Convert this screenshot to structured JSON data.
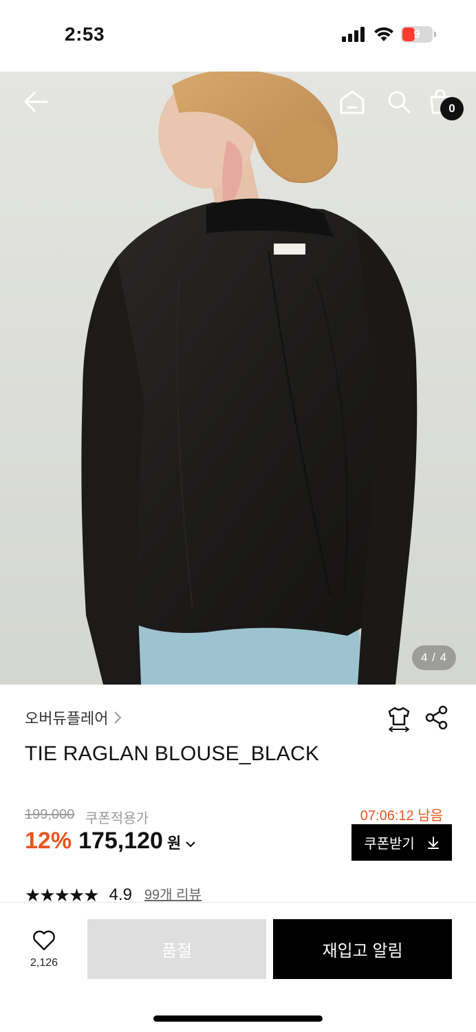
{
  "status_bar": {
    "time": "2:53",
    "battery_level": "9",
    "battery_color": "#ff3b30"
  },
  "header": {
    "back_icon": "arrow-left-icon",
    "home_icon": "home-icon",
    "search_icon": "search-icon",
    "cart_icon": "shopping-bag-icon",
    "cart_count": "0"
  },
  "gallery": {
    "pager": "4 / 4",
    "image_alt": "Model wearing black raglan blouse, back view",
    "label_text": "overdue flair"
  },
  "product": {
    "brand": "오버듀플레어",
    "title": "TIE RAGLAN BLOUSE_BLACK",
    "original_price": "199,000",
    "coupon_note": "쿠폰적용가",
    "discount": "12%",
    "price": "175,120",
    "currency": "원",
    "timer": "07:06:12 남음",
    "coupon_button": "쿠폰받기",
    "rating_stars": "★★★★★",
    "rating": "4.9",
    "review_count": "99개 리뷰",
    "accent_color": "#e8551f"
  },
  "bottom_bar": {
    "like_count": "2,126",
    "soldout_label": "품절",
    "restock_label": "재입고 알림"
  }
}
